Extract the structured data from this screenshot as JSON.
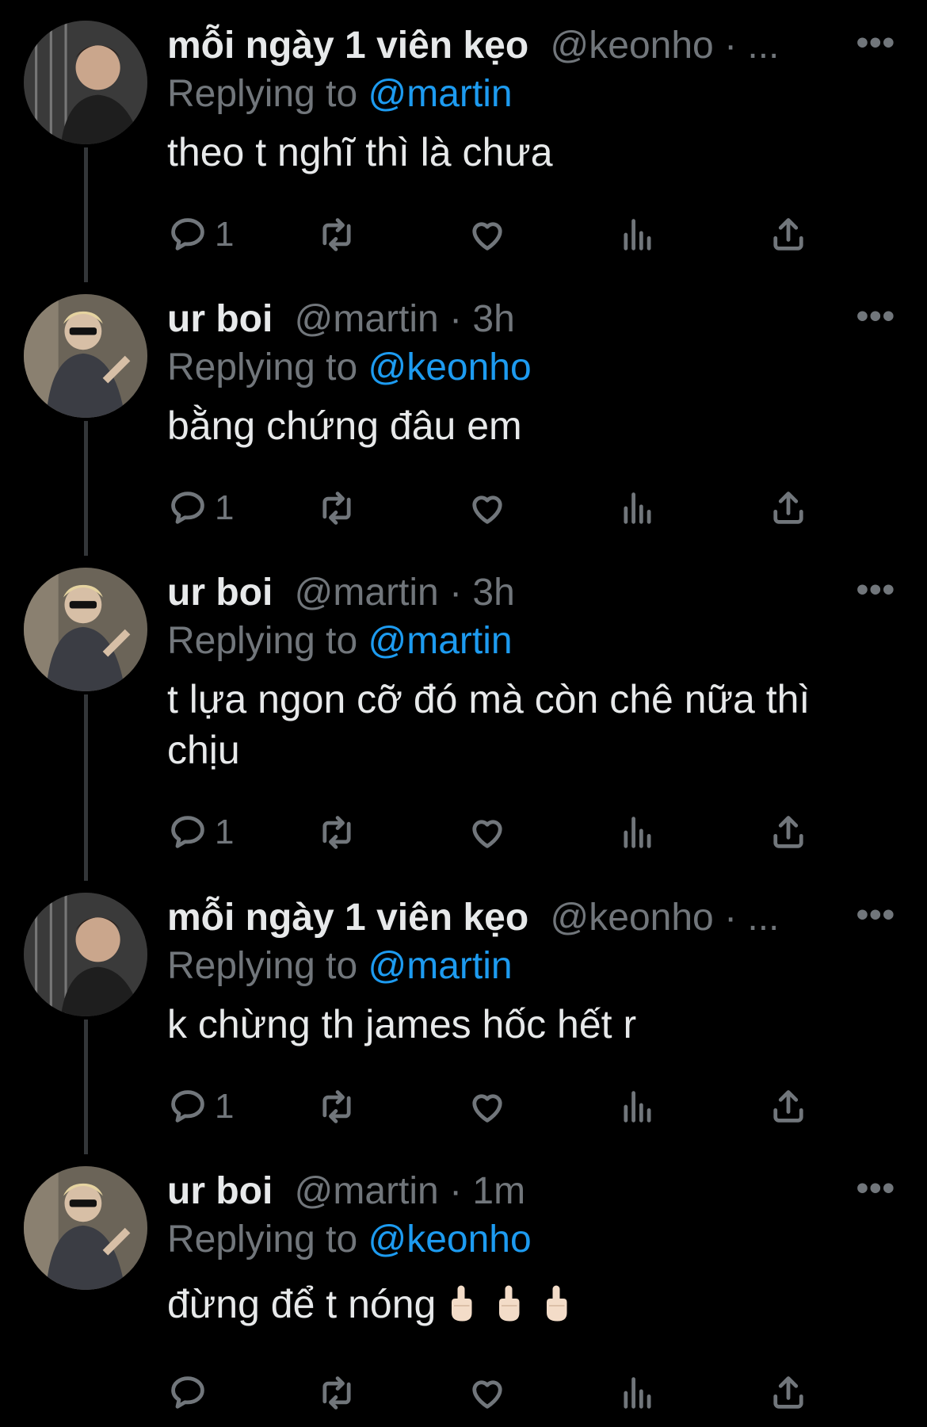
{
  "tweets": [
    {
      "name": "mỗi ngày 1 viên kẹo",
      "handle": "@keonho",
      "meta": "· ...",
      "replying_label": "Replying to",
      "replying_to": "@martin",
      "text": "theo t nghĩ thì là chưa",
      "reply_count": "1",
      "avatar": "avatar-keonho"
    },
    {
      "name": "ur boi",
      "handle": "@martin",
      "meta": "· 3h",
      "replying_label": "Replying to",
      "replying_to": "@keonho",
      "text": "bằng chứng đâu em",
      "reply_count": "1",
      "avatar": "avatar-martin"
    },
    {
      "name": "ur boi",
      "handle": "@martin",
      "meta": "· 3h",
      "replying_label": "Replying to",
      "replying_to": "@martin",
      "text": "t lựa ngon cỡ đó mà còn chê nữa thì chịu",
      "reply_count": "1",
      "avatar": "avatar-martin"
    },
    {
      "name": "mỗi ngày 1 viên kẹo",
      "handle": "@keonho",
      "meta": "· ...",
      "replying_label": "Replying to",
      "replying_to": "@martin",
      "text": "k chừng th james hốc hết r",
      "reply_count": "1",
      "avatar": "avatar-keonho"
    },
    {
      "name": "ur boi",
      "handle": "@martin",
      "meta": "· 1m",
      "replying_label": "Replying to",
      "replying_to": "@keonho",
      "text": "đừng để t nóng",
      "reply_count": "",
      "avatar": "avatar-martin",
      "emoji_count": 3
    }
  ],
  "more_label": "•••",
  "icons": [
    "reply-icon",
    "retweet-icon",
    "like-icon",
    "stats-icon",
    "share-icon",
    "more-icon"
  ],
  "colors": {
    "background": "#000000",
    "text": "#e7e9ea",
    "muted": "#71767b",
    "accent": "#1d9bf0"
  }
}
